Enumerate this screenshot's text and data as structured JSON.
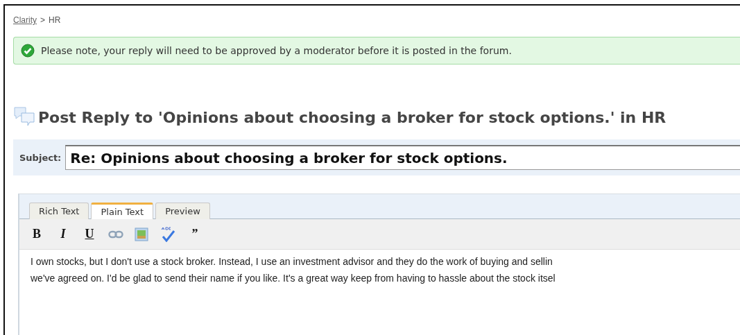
{
  "breadcrumb": {
    "link": "Clarity",
    "separator": ">",
    "current": "HR"
  },
  "notice": {
    "kind": "success",
    "text": "Please note, your reply will need to be approved by a moderator before it is posted in the forum."
  },
  "heading": "Post Reply to 'Opinions about choosing a broker for stock options.' in HR",
  "subject": {
    "label": "Subject:",
    "value": "Re: Opinions about choosing a broker for stock options."
  },
  "editor": {
    "tabs": [
      {
        "label": "Rich Text",
        "selected": false
      },
      {
        "label": "Plain Text",
        "selected": true
      },
      {
        "label": "Preview",
        "selected": false
      }
    ],
    "toolbar": [
      {
        "kind": "bold",
        "label": "B"
      },
      {
        "kind": "italic",
        "label": "I"
      },
      {
        "kind": "underline",
        "label": "U"
      },
      {
        "kind": "link"
      },
      {
        "kind": "image"
      },
      {
        "kind": "spellcheck"
      },
      {
        "kind": "quote",
        "label": "”"
      }
    ],
    "lines": [
      "I own stocks, but I don't use a stock broker. Instead, I use an investment advisor and they do the work of buying and sellin",
      "we've agreed on. I'd be glad to send their name if you like. It's a great way keep from having to hassle about the stock itsel"
    ]
  }
}
